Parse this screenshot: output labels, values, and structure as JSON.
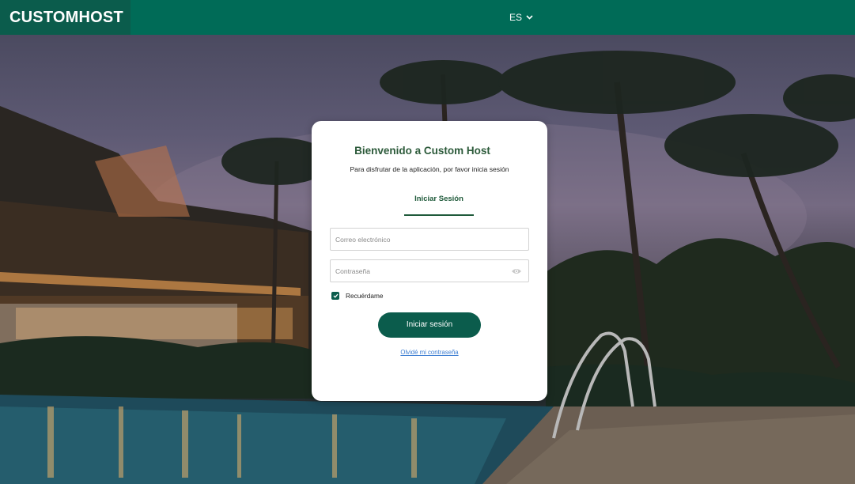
{
  "header": {
    "brand": "CUSTOMHOST",
    "language": "ES"
  },
  "login": {
    "title": "Bienvenido a Custom Host",
    "subtitle": "Para disfrutar de la aplicación, por favor inicia sesión",
    "tab_label": "Iniciar Sesión",
    "email_placeholder": "Correo electrónico",
    "password_placeholder": "Contraseña",
    "remember_label": "Recuérdame",
    "remember_checked": true,
    "submit_label": "Iniciar sesión",
    "forgot_label": "Olvidé mi contraseña"
  },
  "colors": {
    "primary": "#0b5c4c",
    "header": "#006b57",
    "link": "#3f7fd2"
  },
  "icons": [
    "chevron-down-icon",
    "eye-icon",
    "check-icon"
  ]
}
